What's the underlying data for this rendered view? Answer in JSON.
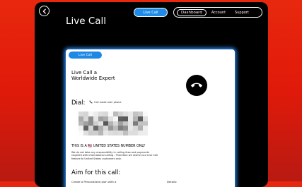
{
  "header": {
    "title": "Live Call",
    "active_pill": "Live Call",
    "nav": [
      "Dashboard",
      "Account",
      "Support"
    ]
  },
  "card": {
    "pill": "Live Call",
    "title": "Live Call a Worldwide Expert",
    "dial_label": "Dial:",
    "dial_note": "Call made over phone",
    "phone_number": "",
    "us_only": "THIS IS A 🇺🇸 UNITED STATES NUMBER ONLY",
    "disclaimer": "We do not take any responsibility in calling fees and payments required with international calling - Therefore we restrict our Live Call feature to United States customers only.",
    "aim_title": "Aim for this call:",
    "aim_text": "Create a Personalized plan with a",
    "details_label": "Details:"
  },
  "icons": {
    "back": "back-arrow-icon",
    "hangup": "phone-hangup-icon",
    "phone": "phone-icon"
  },
  "colors": {
    "accent": "#1e8be8",
    "background": "#e8280e",
    "panel": "#000000",
    "card_glow": "#2a8fff"
  }
}
